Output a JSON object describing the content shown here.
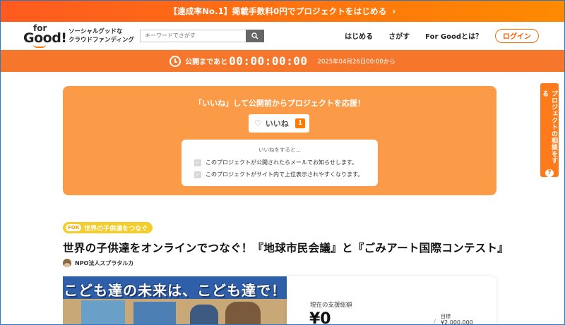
{
  "promo": {
    "text": "【達成率No.1】掲載手数料0円でプロジェクトをはじめる",
    "chevron": "›"
  },
  "header": {
    "logo_top": "for",
    "logo_main": "Good!",
    "tagline_line1": "ソーシャルグッドな",
    "tagline_line2": "クラウドファンディング",
    "search_placeholder": "キーワードでさがす",
    "nav": [
      "はじめる",
      "さがす",
      "For Goodとは？"
    ],
    "login_label": "ログイン"
  },
  "countdown": {
    "label": "公開まであと",
    "time": "00:00:00:00",
    "date": "2025年04月26日00:00から"
  },
  "like_panel": {
    "title": "「いいね」して公開前からプロジェクトを応援！",
    "button_label": "いいね",
    "count": "1",
    "info_head": "いいねをすると…",
    "benefits": [
      "このプロジェクトが公開されたらメールでお知らせします。",
      "このプロジェクトがサイト内で上位表示されやすくなります。"
    ]
  },
  "side_tab": {
    "label": "プロジェクトの相談をする",
    "icon": "?"
  },
  "project": {
    "category_badge": "FOR",
    "category_label": "世界の子供達をつなぐ",
    "title": "世界の子供達をオンラインでつなぐ！『地球市民会議』と『ごみアート国際コンテスト』",
    "owner": "NPO法人スプラタルカ",
    "image_banner": "こども達の未来は、こども達で！"
  },
  "stats": {
    "current_label": "現在の支援総額",
    "current_amount": "¥0",
    "slash": "/",
    "goal_label": "目標",
    "goal_amount": "¥2,000,000"
  },
  "colors": {
    "accent": "#ff7a00",
    "countdown_bg": "#f6772b",
    "panel_bg": "#fb9a47",
    "category_bg": "#f5cd2a"
  }
}
